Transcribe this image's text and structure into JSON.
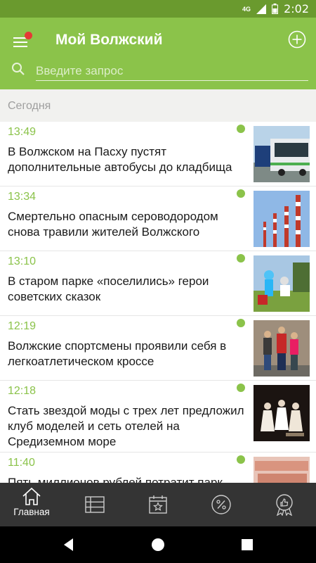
{
  "status_bar": {
    "network": "4G",
    "time": "2:02"
  },
  "app_bar": {
    "title": "Мой Волжский",
    "has_notification": true
  },
  "search": {
    "placeholder": "Введите запрос",
    "value": ""
  },
  "section": {
    "label": "Сегодня"
  },
  "news": [
    {
      "time": "13:49",
      "title": "В Волжском на Пасху пустят дополнительные автобусы до кладбища",
      "thumb": "bus"
    },
    {
      "time": "13:34",
      "title": "Смертельно опасным сероводородом снова травили жителей Волжского",
      "thumb": "chimneys"
    },
    {
      "time": "13:10",
      "title": "В старом парке «поселились» герои советских сказок",
      "thumb": "park-figures"
    },
    {
      "time": "12:19",
      "title": "Волжские спортсмены проявили себя в легкоатлетическом кроссе",
      "thumb": "athletes"
    },
    {
      "time": "12:18",
      "title": "Стать звездой моды с трех лет предложил клуб моделей и сеть отелей на Средиземном море",
      "thumb": "models"
    },
    {
      "time": "11:40",
      "title": "Пять миллионов рублей потратит парк",
      "thumb": "money"
    }
  ],
  "bottom_nav": [
    {
      "label": "Главная",
      "icon": "home-icon",
      "active": true
    },
    {
      "label": "",
      "icon": "list-icon",
      "active": false
    },
    {
      "label": "",
      "icon": "calendar-star-icon",
      "active": false
    },
    {
      "label": "",
      "icon": "percent-icon",
      "active": false
    },
    {
      "label": "",
      "icon": "award-thumb-icon",
      "active": false
    }
  ],
  "colors": {
    "accent": "#8bc34a",
    "status_bar": "#6a9a2e",
    "nav_bg": "#343434",
    "unread": "#8bc34a",
    "notification": "#e53935"
  }
}
